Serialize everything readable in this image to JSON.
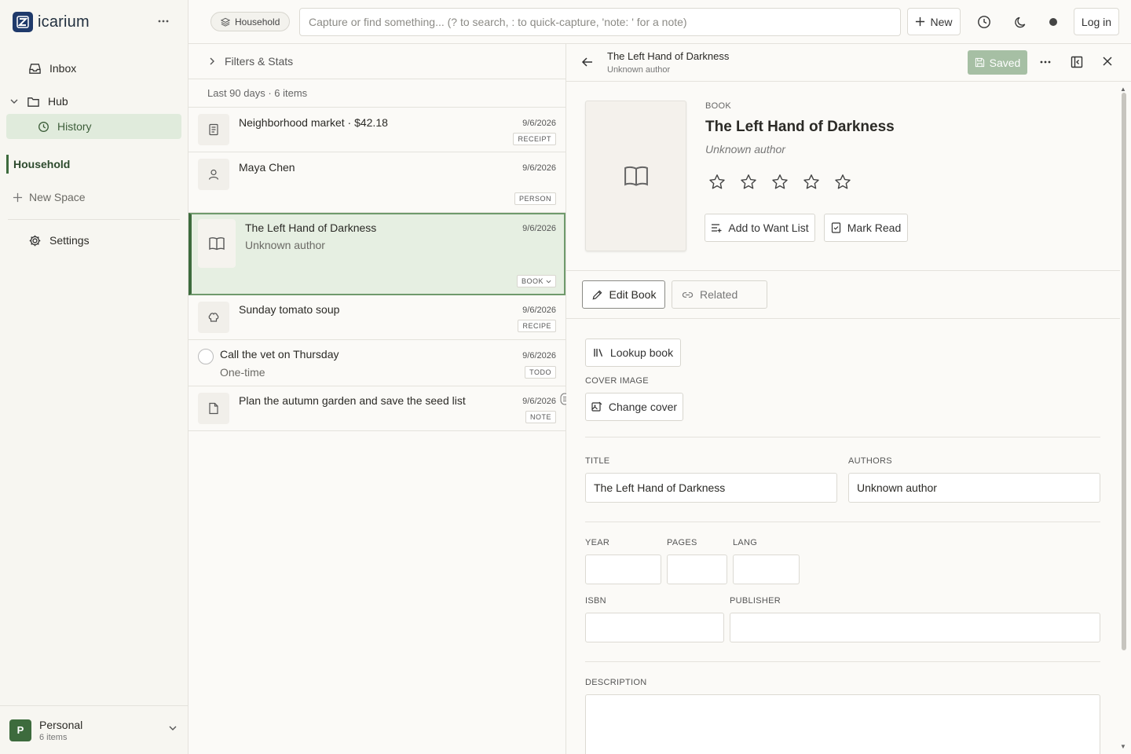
{
  "app": {
    "name": "icarium",
    "colors": {
      "accent": "#3d6b3d",
      "selected_bg": "#e6efe2",
      "logo": "#1f3a6b"
    }
  },
  "sidebar": {
    "inbox": "Inbox",
    "hub": "Hub",
    "history": "History",
    "space": "Household",
    "new_space": "New Space",
    "settings": "Settings",
    "profile": {
      "initial": "P",
      "name": "Personal",
      "count": "6 items"
    }
  },
  "topbar": {
    "space_chip": "Household",
    "search_placeholder": "Capture or find something... (? to search, : to quick-capture, 'note: ' for a note)",
    "new_label": "New",
    "login_label": "Log in"
  },
  "list": {
    "filters_label": "Filters & Stats",
    "summary": "Last 90 days · 6 items",
    "items": [
      {
        "title": "Neighborhood market · $42.18",
        "date": "9/6/2026",
        "badge": "RECEIPT",
        "icon": "receipt-icon"
      },
      {
        "title": "Maya Chen",
        "date": "9/6/2026",
        "badge": "PERSON",
        "icon": "person-icon"
      },
      {
        "title": "The Left Hand of Darkness",
        "sub": "Unknown author",
        "date": "9/6/2026",
        "badge": "BOOK",
        "icon": "book-icon",
        "selected": true
      },
      {
        "title": "Sunday tomato soup",
        "date": "9/6/2026",
        "badge": "RECIPE",
        "icon": "chef-hat-icon"
      },
      {
        "title": "Call the vet on Thursday",
        "sub": "One-time",
        "date": "9/6/2026",
        "badge": "TODO",
        "icon": "todo-circle-icon"
      },
      {
        "title": "Plan the autumn garden and save the seed list",
        "date": "9/6/2026",
        "badge": "NOTE",
        "icon": "note-icon"
      }
    ]
  },
  "detail": {
    "header_title": "The Left Hand of Darkness",
    "header_sub": "Unknown author",
    "saved_label": "Saved",
    "type_label": "BOOK",
    "title": "The Left Hand of Darkness",
    "author": "Unknown author",
    "rating": 0,
    "rating_max": 5,
    "want_list_label": "Add to Want List",
    "mark_read_label": "Mark Read",
    "tab_edit": "Edit Book",
    "tab_related": "Related",
    "lookup_label": "Lookup book",
    "cover_image_label": "COVER IMAGE",
    "change_cover_label": "Change cover",
    "fields": {
      "title_label": "TITLE",
      "title_value": "The Left Hand of Darkness",
      "authors_label": "AUTHORS",
      "authors_value": "Unknown author",
      "year_label": "YEAR",
      "year_value": "",
      "pages_label": "PAGES",
      "pages_value": "",
      "lang_label": "LANG",
      "lang_value": "",
      "isbn_label": "ISBN",
      "isbn_value": "",
      "publisher_label": "PUBLISHER",
      "publisher_value": "",
      "description_label": "DESCRIPTION",
      "description_value": ""
    }
  }
}
